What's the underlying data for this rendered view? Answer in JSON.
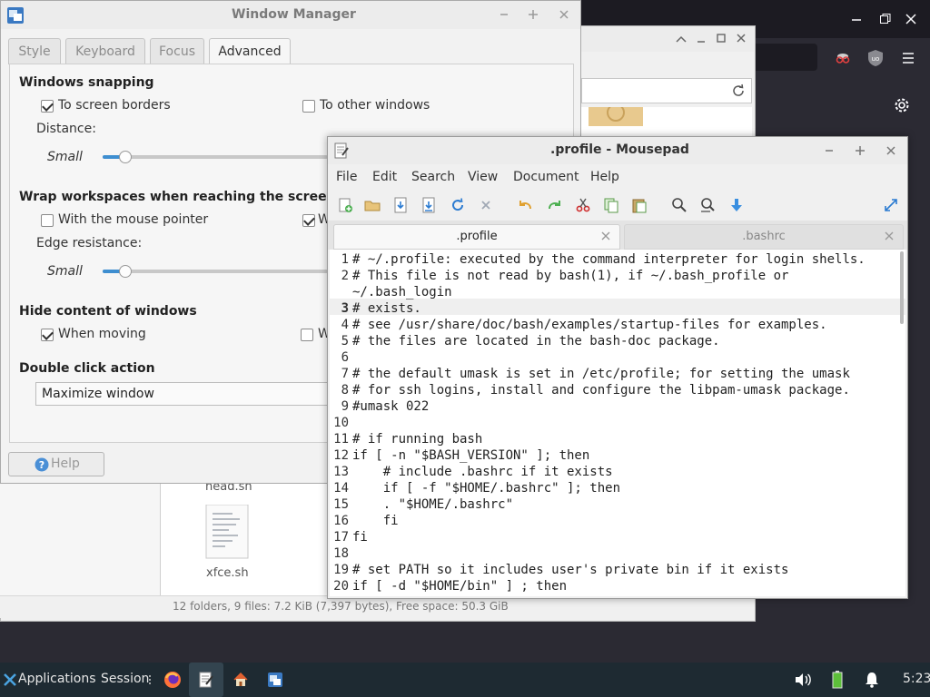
{
  "firefox": {
    "window_buttons": [
      "minimize-icon",
      "restore-icon",
      "close-icon"
    ],
    "toolbar_icons": [
      "mask-icon",
      "ublock-icon",
      "hamburger-menu-icon"
    ],
    "settings_icon": "gear-icon"
  },
  "file_manager": {
    "files": [
      {
        "name": "head.sh"
      },
      {
        "name": "xfce.sh"
      }
    ],
    "status": "12 folders, 9 files: 7.2 KiB (7,397 bytes), Free space: 50.3 GiB"
  },
  "window_manager": {
    "title": "Window Manager",
    "tabs": [
      {
        "label": "Style",
        "active": false
      },
      {
        "label": "Keyboard",
        "active": false
      },
      {
        "label": "Focus",
        "active": false
      },
      {
        "label": "Advanced",
        "active": true
      }
    ],
    "snapping": {
      "title": "Windows snapping",
      "to_screen_borders": "To screen borders",
      "to_screen_borders_checked": true,
      "to_other_windows": "To other windows",
      "to_other_windows_checked": false,
      "distance_label": "Distance:",
      "slider_min_label": "Small",
      "slider_value": 0.05
    },
    "wrap": {
      "title": "Wrap workspaces when reaching the screen",
      "with_mouse_pointer": "With the mouse pointer",
      "with_mouse_pointer_checked": false,
      "second_option_initial": "W",
      "second_option_checked": true,
      "edge_resistance_label": "Edge resistance:",
      "slider_min_label": "Small",
      "slider_value": 0.05
    },
    "hide": {
      "title": "Hide content of windows",
      "when_moving": "When moving",
      "when_moving_checked": true,
      "second_option_initial": "W",
      "second_option_checked": false
    },
    "double_click": {
      "title": "Double click action",
      "selected": "Maximize window"
    },
    "help_button": "Help"
  },
  "mousepad": {
    "title": ".profile - Mousepad",
    "menu": [
      "File",
      "Edit",
      "Search",
      "View",
      "Document",
      "Help"
    ],
    "toolbar": [
      "new-document-icon",
      "open-folder-icon",
      "save-icon",
      "save-as-icon",
      "reload-icon",
      "close-document-icon",
      "undo-icon",
      "redo-icon",
      "cut-icon",
      "copy-icon",
      "paste-icon",
      "find-icon",
      "find-replace-icon",
      "goto-icon",
      "fullscreen-icon"
    ],
    "tabs": [
      {
        "label": ".profile",
        "active": true
      },
      {
        "label": ".bashrc",
        "active": false
      }
    ],
    "current_line": "3",
    "lines": [
      {
        "n": "1",
        "text": "# ~/.profile: executed by the command interpreter for login shells."
      },
      {
        "n": "2",
        "text": "# This file is not read by bash(1), if ~/.bash_profile or"
      },
      {
        "n": "",
        "text": "~/.bash_login"
      },
      {
        "n": "3",
        "text": "# exists."
      },
      {
        "n": "4",
        "text": "# see /usr/share/doc/bash/examples/startup-files for examples."
      },
      {
        "n": "5",
        "text": "# the files are located in the bash-doc package."
      },
      {
        "n": "6",
        "text": ""
      },
      {
        "n": "7",
        "text": "# the default umask is set in /etc/profile; for setting the umask"
      },
      {
        "n": "8",
        "text": "# for ssh logins, install and configure the libpam-umask package."
      },
      {
        "n": "9",
        "text": "#umask 022"
      },
      {
        "n": "10",
        "text": ""
      },
      {
        "n": "11",
        "text": "# if running bash"
      },
      {
        "n": "12",
        "text": "if [ -n \"$BASH_VERSION\" ]; then"
      },
      {
        "n": "13",
        "text": "    # include .bashrc if it exists"
      },
      {
        "n": "14",
        "text": "    if [ -f \"$HOME/.bashrc\" ]; then"
      },
      {
        "n": "15",
        "text": "    . \"$HOME/.bashrc\""
      },
      {
        "n": "16",
        "text": "    fi"
      },
      {
        "n": "17",
        "text": "fi"
      },
      {
        "n": "18",
        "text": ""
      },
      {
        "n": "19",
        "text": "# set PATH so it includes user's private bin if it exists"
      },
      {
        "n": "20",
        "text": "if [ -d \"$HOME/bin\" ] ; then"
      }
    ]
  },
  "taskbar": {
    "applications_label": "Applications",
    "session_label": "Session",
    "clock": "5:23"
  }
}
